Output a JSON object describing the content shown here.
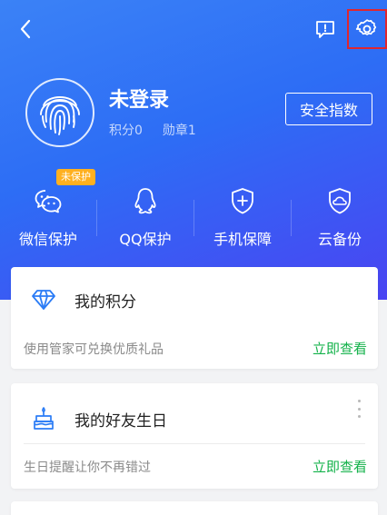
{
  "header": {
    "back_icon": "back-chevron-icon",
    "feedback_icon": "feedback-icon",
    "settings_icon": "settings-gear-icon",
    "highlight_color": "#e0262f"
  },
  "profile": {
    "avatar_icon": "fingerprint-icon",
    "username": "未登录",
    "points": "积分0",
    "medals": "勋章1",
    "safety_button": "安全指数"
  },
  "quick_actions": [
    {
      "label": "微信保护",
      "icon": "wechat-icon",
      "badge": "未保护"
    },
    {
      "label": "QQ保护",
      "icon": "qq-icon"
    },
    {
      "label": "手机保障",
      "icon": "shield-plus-icon"
    },
    {
      "label": "云备份",
      "icon": "cloud-backup-icon"
    }
  ],
  "cards": [
    {
      "title": "我的积分",
      "icon": "diamond-icon",
      "description": "使用管家可兑换优质礼品",
      "link": "立即查看"
    },
    {
      "title": "我的好友生日",
      "icon": "birthday-cake-icon",
      "description": "生日提醒让你不再错过",
      "link": "立即查看"
    }
  ],
  "colors": {
    "hero_gradient_start": "#3b82f6",
    "hero_gradient_end": "#4a44f2",
    "link_green": "#13b24a",
    "badge_orange": "#ffb01f"
  }
}
